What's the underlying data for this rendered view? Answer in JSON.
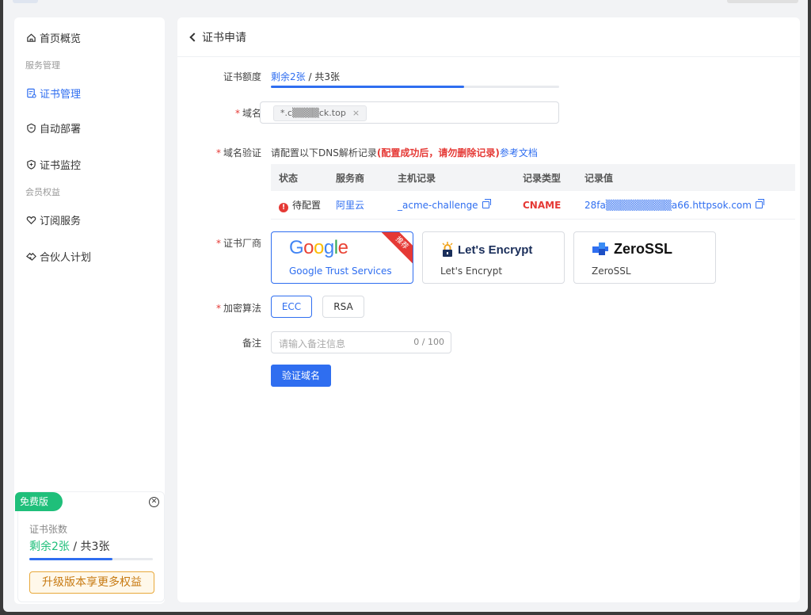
{
  "sidebar": {
    "home": "首页概览",
    "group_service": "服务管理",
    "cert_manage": "证书管理",
    "auto_deploy": "自动部署",
    "cert_monitor": "证书监控",
    "group_member": "会员权益",
    "subscription": "订阅服务",
    "partner": "合伙人计划"
  },
  "promo": {
    "badge": "免费版",
    "label": "证书张数",
    "remaining": "剩余2张",
    "sep_total": " / 共3张",
    "progress": 0.67,
    "upgrade": "升级版本享更多权益"
  },
  "page": {
    "title": "证书申请"
  },
  "form": {
    "quota_label": "证书额度",
    "quota_remaining": "剩余2张",
    "quota_total": " / 共3张",
    "quota_progress": 0.67,
    "domain_label": "域名",
    "domain_tag": "*.c▒▒▒▒ck.top",
    "domain_tag_close": "×",
    "verify_label": "域名验证",
    "verify_prefix": "请配置以下DNS解析记录",
    "verify_warn": "(配置成功后，请勿删除记录)",
    "verify_link": "参考文档",
    "vendor_label": "证书厂商",
    "algo_label": "加密算法",
    "note_label": "备注",
    "note_placeholder": "请输入备注信息",
    "note_count": "0 / 100",
    "submit": "验证域名"
  },
  "dns_table": {
    "headers": [
      "状态",
      "服务商",
      "主机记录",
      "记录类型",
      "记录值"
    ],
    "row": {
      "status": "待配置",
      "provider": "阿里云",
      "host": "_acme-challenge",
      "type": "CNAME",
      "value": "28fa▒▒▒▒▒▒▒▒▒a66.httpsok.com"
    }
  },
  "vendors": [
    {
      "logo": "Google",
      "name": "Google Trust Services",
      "ribbon": "推荐",
      "selected": true
    },
    {
      "logo": "Let's Encrypt",
      "name": "Let's Encrypt",
      "selected": false
    },
    {
      "logo": "ZeroSSL",
      "name": "ZeroSSL",
      "selected": false
    }
  ],
  "algorithms": [
    {
      "label": "ECC",
      "selected": true
    },
    {
      "label": "RSA",
      "selected": false
    }
  ],
  "colors": {
    "primary": "#2f6ef0",
    "danger": "#e53935",
    "success": "#1fbf7a",
    "warning": "#e8a83a"
  },
  "icons": [
    "home-icon",
    "cert-icon",
    "deploy-icon",
    "shield-icon",
    "heart-icon",
    "handshake-icon",
    "close-circle-icon",
    "copy-icon",
    "warning-icon"
  ]
}
